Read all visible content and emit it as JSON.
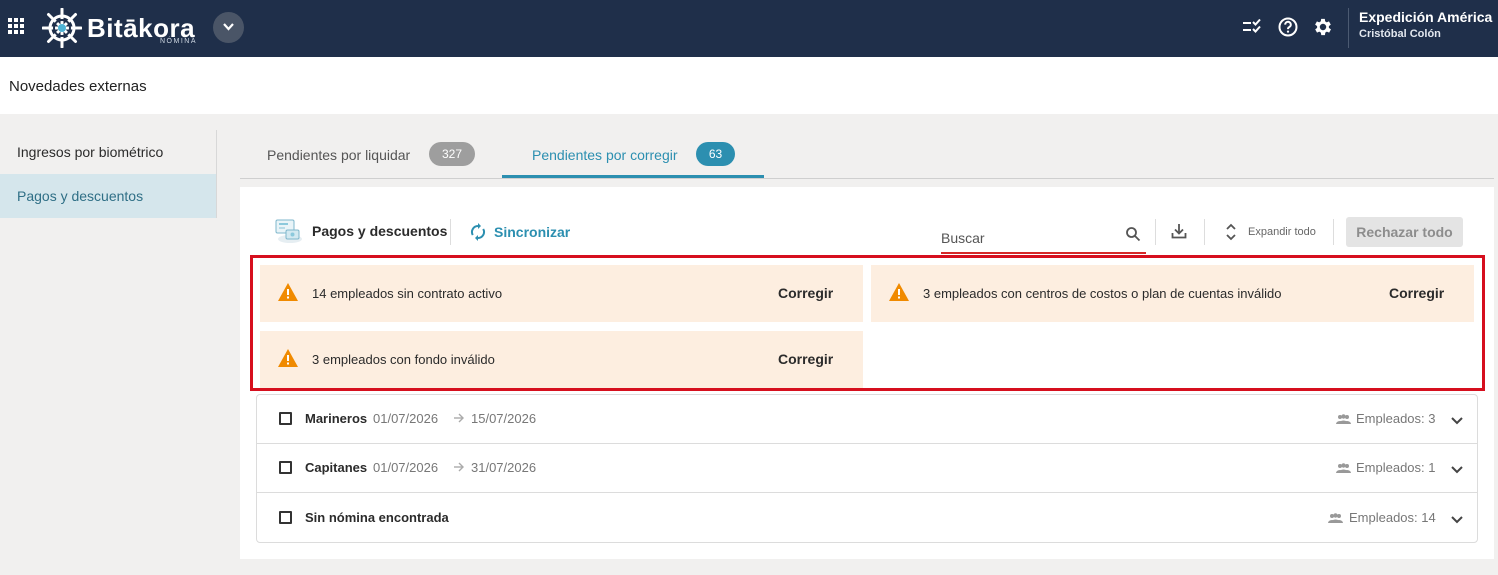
{
  "header": {
    "brand": "Bitākora",
    "brand_sub": "NÓMINA",
    "company": "Expedición América",
    "user": "Cristóbal Colón",
    "icons": [
      "apps-grid-icon",
      "chevron-down-icon",
      "task-list-icon",
      "help-icon",
      "gear-icon"
    ]
  },
  "page": {
    "title": "Novedades externas"
  },
  "sidebar": {
    "items": [
      {
        "label": "Ingresos por biométrico",
        "active": false
      },
      {
        "label": "Pagos y descuentos",
        "active": true
      }
    ]
  },
  "tabs": [
    {
      "label": "Pendientes por liquidar",
      "count": "327",
      "active": false
    },
    {
      "label": "Pendientes por corregir",
      "count": "63",
      "active": true
    }
  ],
  "toolbar": {
    "title": "Pagos y descuentos",
    "sync_label": "Sincronizar",
    "search_placeholder": "Buscar",
    "expand_label": "Expandir todo",
    "reject_label": "Rechazar todo"
  },
  "warnings": [
    {
      "text": "14 empleados sin contrato activo",
      "action": "Corregir"
    },
    {
      "text": "3 empleados con centros de costos o plan de cuentas inválido",
      "action": "Corregir"
    },
    {
      "text": "3 empleados con fondo inválido",
      "action": "Corregir"
    }
  ],
  "groups": [
    {
      "name": "Marineros",
      "start": "01/07/2026",
      "end": "15/07/2026",
      "employees": "Empleados: 3"
    },
    {
      "name": "Capitanes",
      "start": "01/07/2026",
      "end": "31/07/2026",
      "employees": "Empleados: 1"
    },
    {
      "name": "Sin nómina encontrada",
      "start": "",
      "end": "",
      "employees": "Empleados: 14"
    }
  ],
  "colors": {
    "topbar": "#1f2f4a",
    "accent": "#2c8fb0",
    "warning_bg": "#fdeee0",
    "warning_icon": "#f08a00",
    "highlight_frame": "#d60f1e"
  }
}
